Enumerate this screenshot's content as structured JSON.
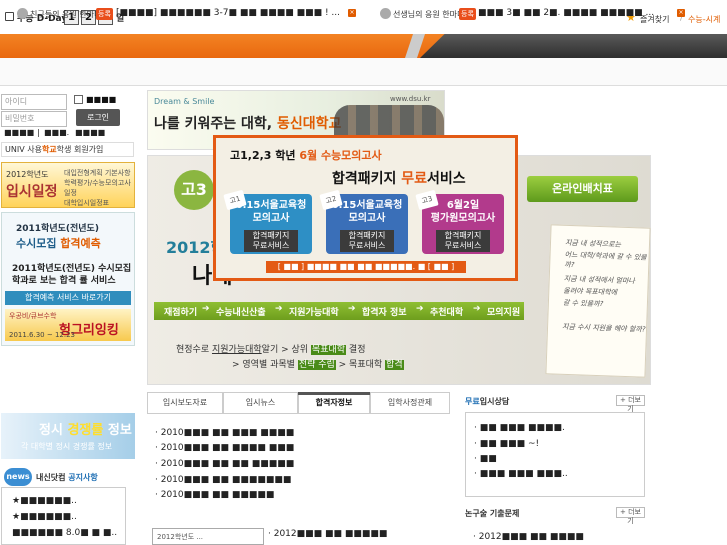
{
  "topbar": {
    "dday_label": "수능 D-Day",
    "dday_digits": [
      "1",
      "2",
      "5"
    ],
    "dday_unit": "일",
    "favorites": "즐겨찾기",
    "separator": "/",
    "link_right": "수능-시계"
  },
  "ticker": {
    "left_title": "친구들의 응원 한마디",
    "left_badge": "등록",
    "left_text": "[■■■■] ■■■■■■ 3-7■ ■■ ■■■■ ■■■ ! ...",
    "right_title": "선생님의 응원 한마디",
    "right_badge": "등록",
    "right_text": "■■■ 3■ ■■ 2■. ■■■■ ■■■■■ ...",
    "close": "×"
  },
  "login": {
    "id_placeholder": "아이디",
    "pw_placeholder": "비밀번호",
    "save_label": "■■■■",
    "button": "로그인",
    "links": [
      "■■■■",
      "|",
      "■■■.",
      "■■■■"
    ],
    "univ_prefix": "UNIV 사용",
    "univ_orange": "학교",
    "univ_suffix": "학생",
    "signup": "회원가입"
  },
  "banners": {
    "schedule_top": "2012학년도",
    "schedule_main": "입시일정",
    "schedule_side": [
      "대입전형계획 기본사항",
      "학력평가/수능모의고사일정",
      "대학입시일정표"
    ],
    "susi_top": "2011학년도(전년도)",
    "susi_main_a": "수시모집 ",
    "susi_main_b": "합격예측",
    "susi_desc": "2011학년도(전년도) 수시모집 학과로 보는 합격 률 서비스",
    "susi_bar": "합격예측 서비스 바로가기",
    "promo_top": "우공비/큐브수학",
    "promo_main": "헝그리잉킹",
    "promo_date": "2011.6.30 ~ 12.23",
    "jungsi_a": "정시 ",
    "jungsi_b": "경쟁률",
    "jungsi_c": " 정보",
    "jungsi_sub": "각 대학별 정시 경쟁률 정보"
  },
  "news": {
    "badge": "news",
    "title_a": "내신닷컴 ",
    "title_b": "공지사항",
    "items": [
      "★■■■■■■..",
      "★■■■■■■..",
      "■■■■■■ 8.0■ ■ ■.."
    ]
  },
  "dsu": {
    "tag": "Dream & Smile",
    "slogan_a": "나를 키워주는 대학, ",
    "slogan_b": "동신대학교",
    "url": "www.dsu.kr"
  },
  "hero": {
    "logo": "고3",
    "year": "2012학",
    "big": "나에",
    "online_btn": "온라인배치표",
    "note_lines": [
      "지금 내 성적으로는",
      "어느 대학/학과에 갈 수 있을까?",
      "",
      "지금 내 성적에서 얼마나",
      "올려야 목표대학에",
      "갈 수 있을까?",
      "",
      "지금 수시 지원을 해야 할까?"
    ]
  },
  "flow": [
    "재점하기",
    "수능내신산출",
    "지원가능대학",
    "합격자 정보",
    "추천대학",
    "모의지원"
  ],
  "path": {
    "a": "현정수로 ",
    "a_u": "지원가능대학",
    "a2": "알기 > 상위 ",
    "a_r": "목표대학",
    "a3": " 결정",
    "b": "> 영역별 과목별 ",
    "b_r": "전략 수립",
    "b2": " > 목표대학 ",
    "b_r2": "합격"
  },
  "popup": {
    "line1_a": "고1,2,3 학년 ",
    "line1_b": "6월 수능모의고사",
    "line2_a": "합격패키지 ",
    "line2_b": "무료",
    "line2_c": "서비스",
    "cards": [
      {
        "num": "고1",
        "title": "6.15서울교육청\n모의고사",
        "btn": "합격패키지\n무료서비스",
        "color": "#2e8fc5"
      },
      {
        "num": "고2",
        "title": "6.15서울교육청\n모의고사",
        "btn": "합격패키지\n무료서비스",
        "color": "#3a6fb8"
      },
      {
        "num": "고3",
        "title": "6월2일\n평가원모의고사",
        "btn": "합격패키지\n무료서비스",
        "color": "#b23a8c"
      }
    ],
    "footer": "[ ■■ ] ■■■■ ■■ ■■ ■■■■■. ■ [ ■■ ]"
  },
  "tabs": [
    "입시보도자료",
    "입시뉴스",
    "합격자정보",
    "입학사정관제"
  ],
  "tab_items": [
    "2010■■■ ■■ ■■■ ■■■■",
    "2010■■■ ■■ ■■■■ ■■■",
    "2010■■■ ■■ ■■ ■■■■■",
    "2010■■■ ■■ ■■■■■■■",
    "2010■■■ ■■ ■■■■■"
  ],
  "side": {
    "title_a": "무료",
    "title_b": "입시상담",
    "more": "+ 더보기",
    "items": [
      "■■ ■■■ ■■■■.",
      "■■ ■■■ ~!",
      "■■",
      "■■■ ■■■ ■■■.."
    ],
    "title2": "논구술 기출문제",
    "item2": "2012■■■ ■■ ■■■■"
  },
  "bottom": {
    "thumb": "2012학년도 ...",
    "item": "2012■■■ ■■ ■■■■■"
  }
}
